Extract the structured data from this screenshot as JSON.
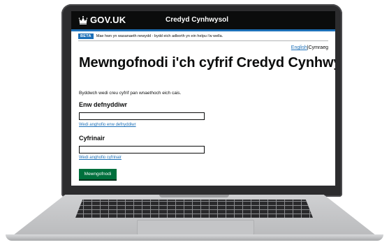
{
  "header": {
    "logo_text": "GOV.UK",
    "service_name": "Credyd Cynhwysol"
  },
  "phase_banner": {
    "tag": "BETA",
    "text": "Mae hwn yn wasanaeth newydd - bydd eich adborth yn ein helpu i'w wella."
  },
  "language": {
    "english": "English",
    "separator": "|",
    "cymraeg": "Cymraeg"
  },
  "page": {
    "title": "Mewngofnodi i'ch cyfrif Credyd Cynhwysol",
    "intro": "Byddwch wedi creu cyfrif pan wnaethoch eich cais."
  },
  "form": {
    "username_label": "Enw defnyddiwr",
    "username_value": "",
    "forgot_username": "Wedi anghofio enw defnyddiwr",
    "password_label": "Cyfrinair",
    "password_value": "",
    "forgot_password": "Wedi anghofio cyfrinair",
    "submit_label": "Mewngofnodi"
  },
  "colors": {
    "header_bg": "#0b0c0c",
    "accent_blue": "#1d70b8",
    "button_green": "#00703c"
  }
}
